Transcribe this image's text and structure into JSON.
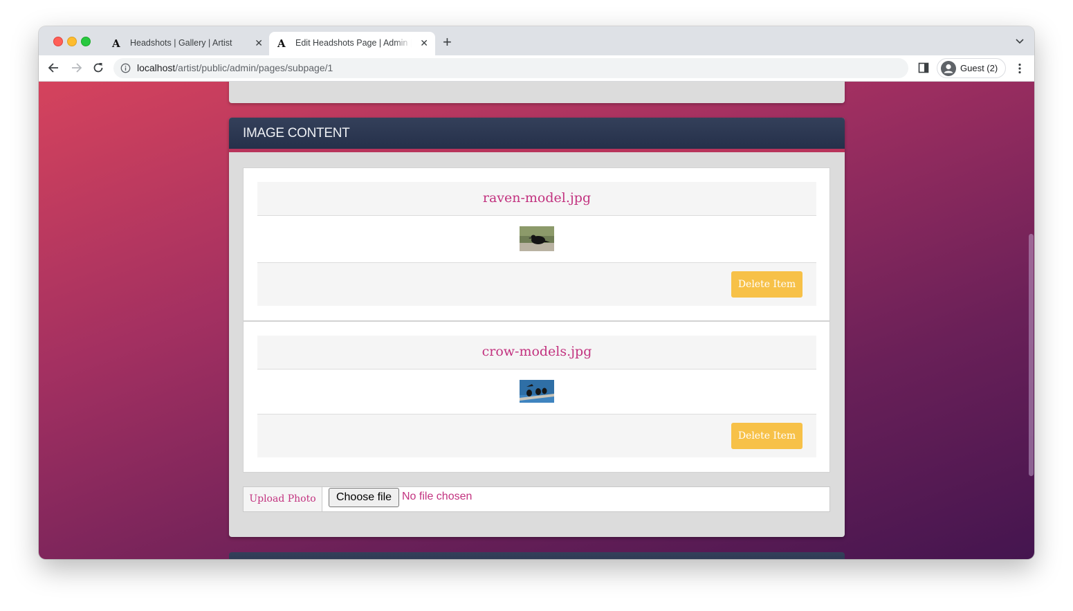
{
  "browser": {
    "tabs": [
      {
        "title": "Headshots | Gallery | Artist",
        "close": "✕",
        "active": false
      },
      {
        "title": "Edit Headshots Page | Admin | Artist",
        "close": "✕",
        "active": true
      }
    ],
    "new_tab": "+",
    "url_host": "localhost",
    "url_path": "/artist/public/admin/pages/subpage/1",
    "profile_label": "Guest (2)",
    "favicon_glyph": "A"
  },
  "panel": {
    "title": "IMAGE CONTENT",
    "items": [
      {
        "filename": "raven-model.jpg",
        "delete_label": "Delete Item"
      },
      {
        "filename": "crow-models.jpg",
        "delete_label": "Delete Item"
      }
    ],
    "upload_label": "Upload Photo",
    "choose_label": "Choose file",
    "no_file_text": "No file chosen"
  },
  "colors": {
    "accent": "#c2327f",
    "button_warning": "#f7c148",
    "panel_header": "#2b3650"
  }
}
